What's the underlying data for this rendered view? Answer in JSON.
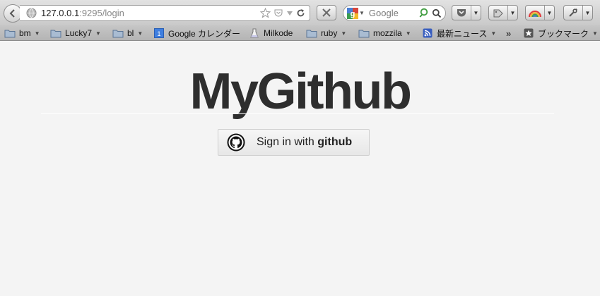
{
  "browser": {
    "url_host": "127.0.0.1",
    "url_rest": ":9295/login",
    "search_placeholder": "Google"
  },
  "bookmarks": [
    {
      "label": "bm",
      "icon": "folder-icon"
    },
    {
      "label": "Lucky7",
      "icon": "folder-icon"
    },
    {
      "label": "bl",
      "icon": "folder-icon"
    },
    {
      "label": "Google カレンダー",
      "icon": "calendar-icon"
    },
    {
      "label": "Milkode",
      "icon": "flask-icon"
    },
    {
      "label": "ruby",
      "icon": "folder-icon"
    },
    {
      "label": "mozzila",
      "icon": "folder-icon"
    },
    {
      "label": "最新ニュース",
      "icon": "rss-icon"
    },
    {
      "label": "ブックマーク",
      "icon": "bookmark-star-icon"
    }
  ],
  "overflow": "»",
  "page": {
    "title": "MyGithub",
    "signin_prefix": "Sign in with ",
    "signin_brand": "github"
  }
}
